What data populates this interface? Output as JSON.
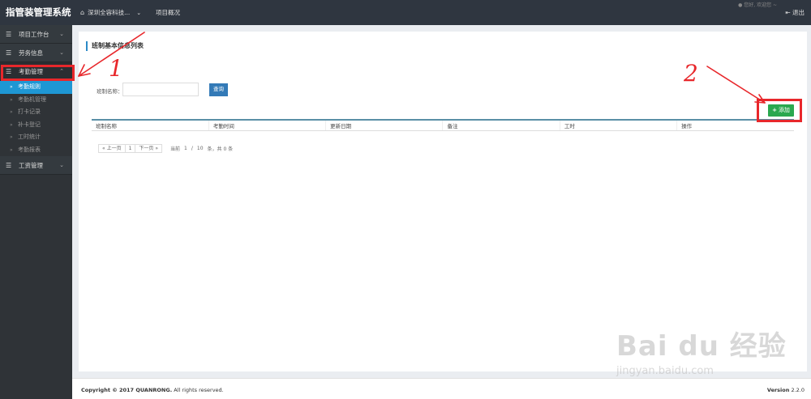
{
  "topbar": {
    "brand": "指管装管理系统",
    "company": "深圳全容科技...",
    "overview": "项目概况",
    "user": "您好, 欢迎您 ~",
    "logout": "退出"
  },
  "sidebar": {
    "groups": [
      {
        "label": "项目工作台"
      },
      {
        "label": "劳务信息"
      },
      {
        "label": "考勤管理",
        "items": [
          "考勤规则",
          "考勤机管理",
          "打卡记录",
          "补卡登记",
          "工时统计",
          "考勤报表"
        ]
      },
      {
        "label": "工资管理"
      }
    ]
  },
  "main": {
    "title": "班制基本信息列表",
    "search_label": "班制名称：",
    "search_value": "",
    "search_button": "查询",
    "add_button": "添加",
    "table_headers": [
      "班制名称",
      "考勤时间",
      "更新日期",
      "备注",
      "工时",
      "操作"
    ],
    "pager": {
      "prev": "« 上一页",
      "current": "1",
      "next": "下一页 »",
      "info_prefix": "当前",
      "page": "1",
      "per": "10",
      "info_suffix": "条，共 0 条"
    }
  },
  "footer": {
    "copyright_bold": "Copyright © 2017 QUANRONG.",
    "copyright_rest": "All rights reserved.",
    "version_label": "Version",
    "version_value": "2.2.0"
  },
  "annotations": {
    "one": "1",
    "two": "2"
  },
  "watermark": {
    "brand": "Bai du 经验",
    "url": "jingyan.baidu.com"
  },
  "colors": {
    "accent": "#1e97d4",
    "add": "#2aa84f",
    "annotation": "#e8272b",
    "query": "#337ab7"
  }
}
